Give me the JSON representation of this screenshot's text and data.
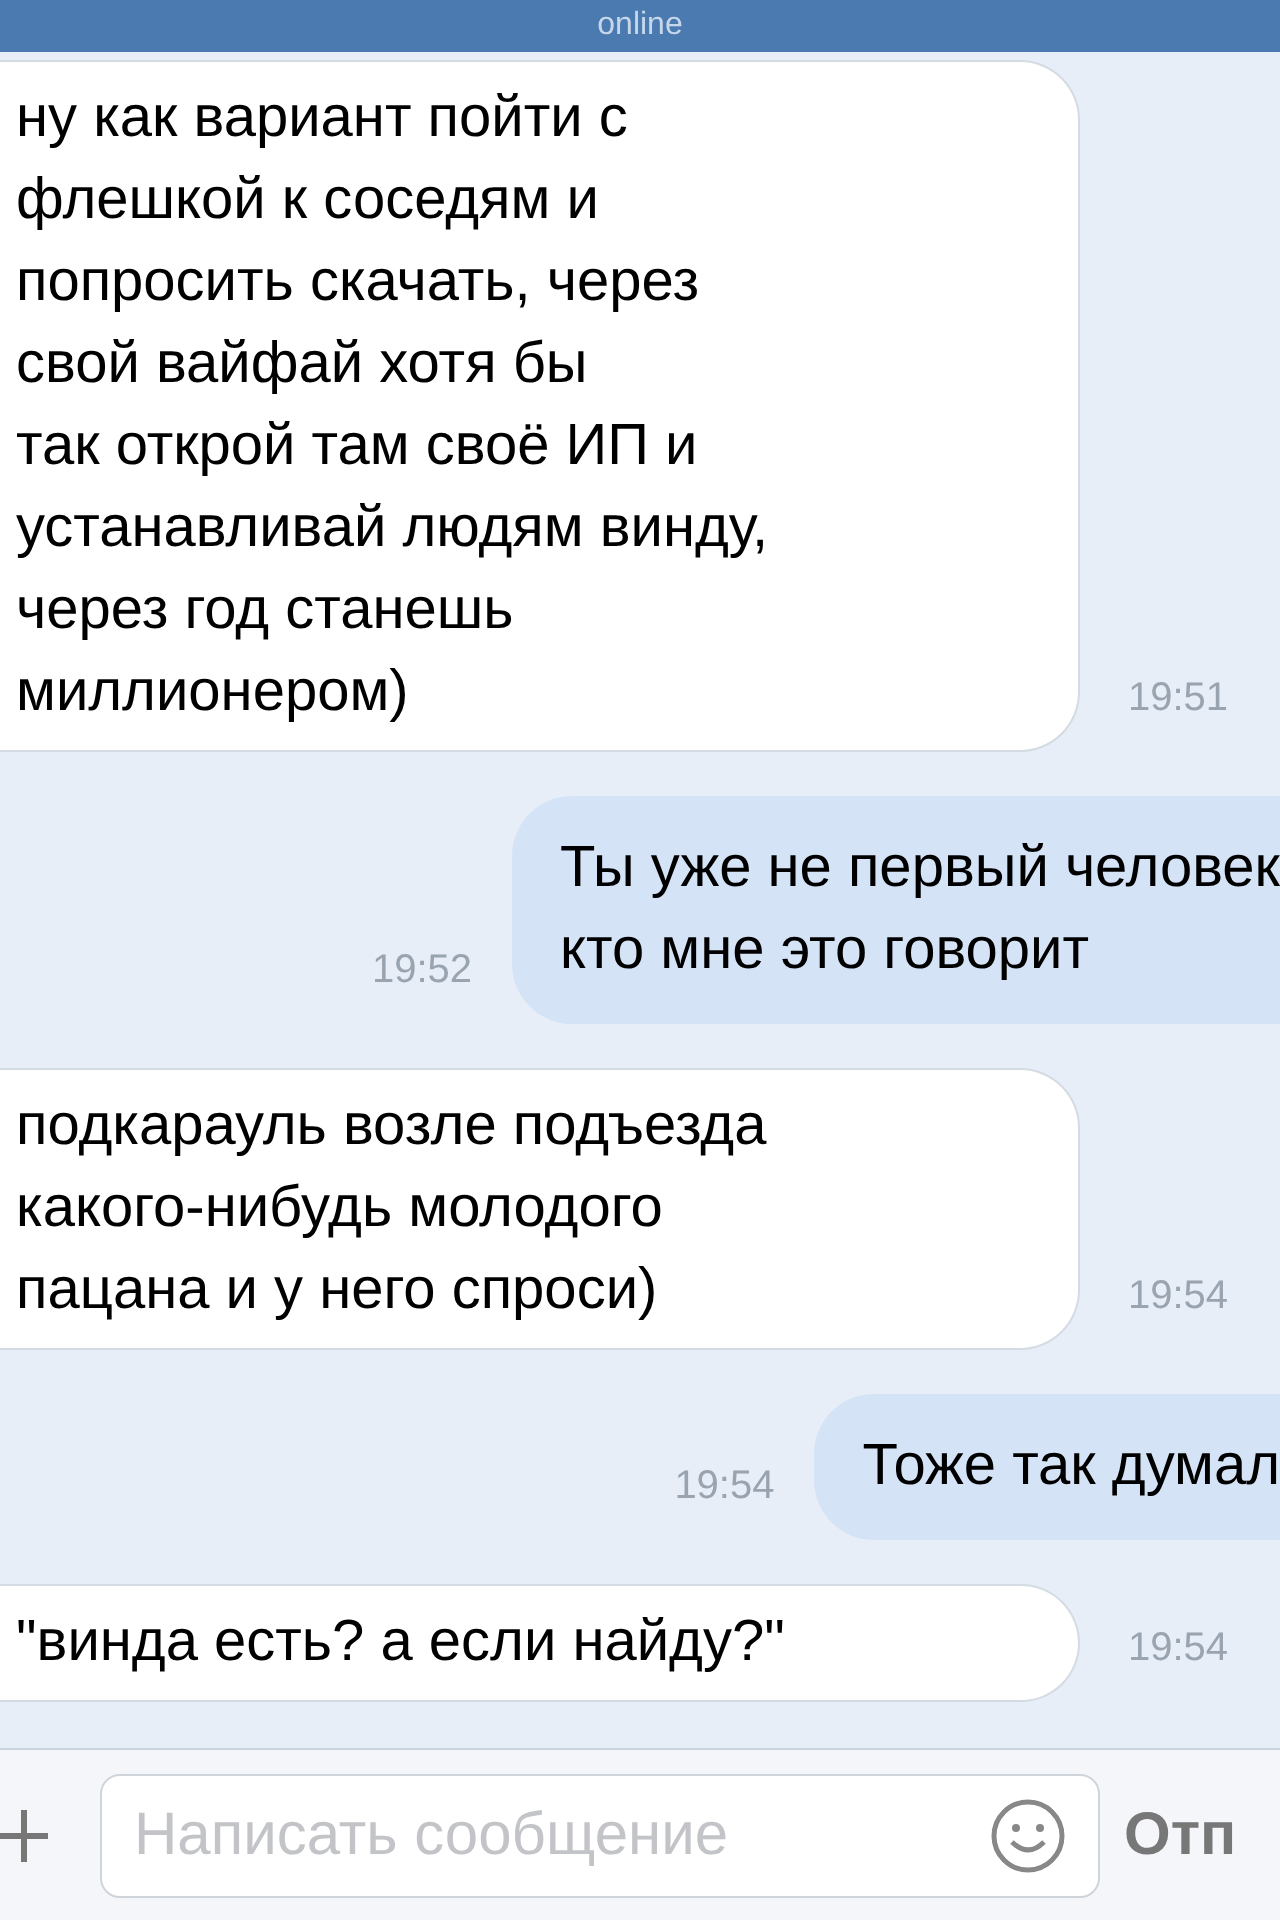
{
  "header": {
    "status": "online"
  },
  "messages": [
    {
      "kind": "incoming",
      "text": "ну как вариант пойти с\nфлешкой к соседям и\nпопросить скачать, через\nсвой вайфай хотя бы\nтак открой там своё ИП и\nустанавливай людям винду,\nчерез год станешь\nмиллионером)",
      "time": "19:51"
    },
    {
      "kind": "outgoing",
      "text": "Ты уже не первый человек\nкто мне это говорит",
      "time": "19:52"
    },
    {
      "kind": "incoming",
      "text": "подкарауль возле подъезда\nкакого-нибудь молодого\nпацана и у него спроси)",
      "time": "19:54"
    },
    {
      "kind": "outgoing",
      "text": "Тоже так думал",
      "time": "19:54"
    },
    {
      "kind": "incoming",
      "text": "\"винда есть? а если найду?\"",
      "time": "19:54"
    }
  ],
  "composer": {
    "placeholder": "Написать сообщение",
    "send": "Отп"
  }
}
